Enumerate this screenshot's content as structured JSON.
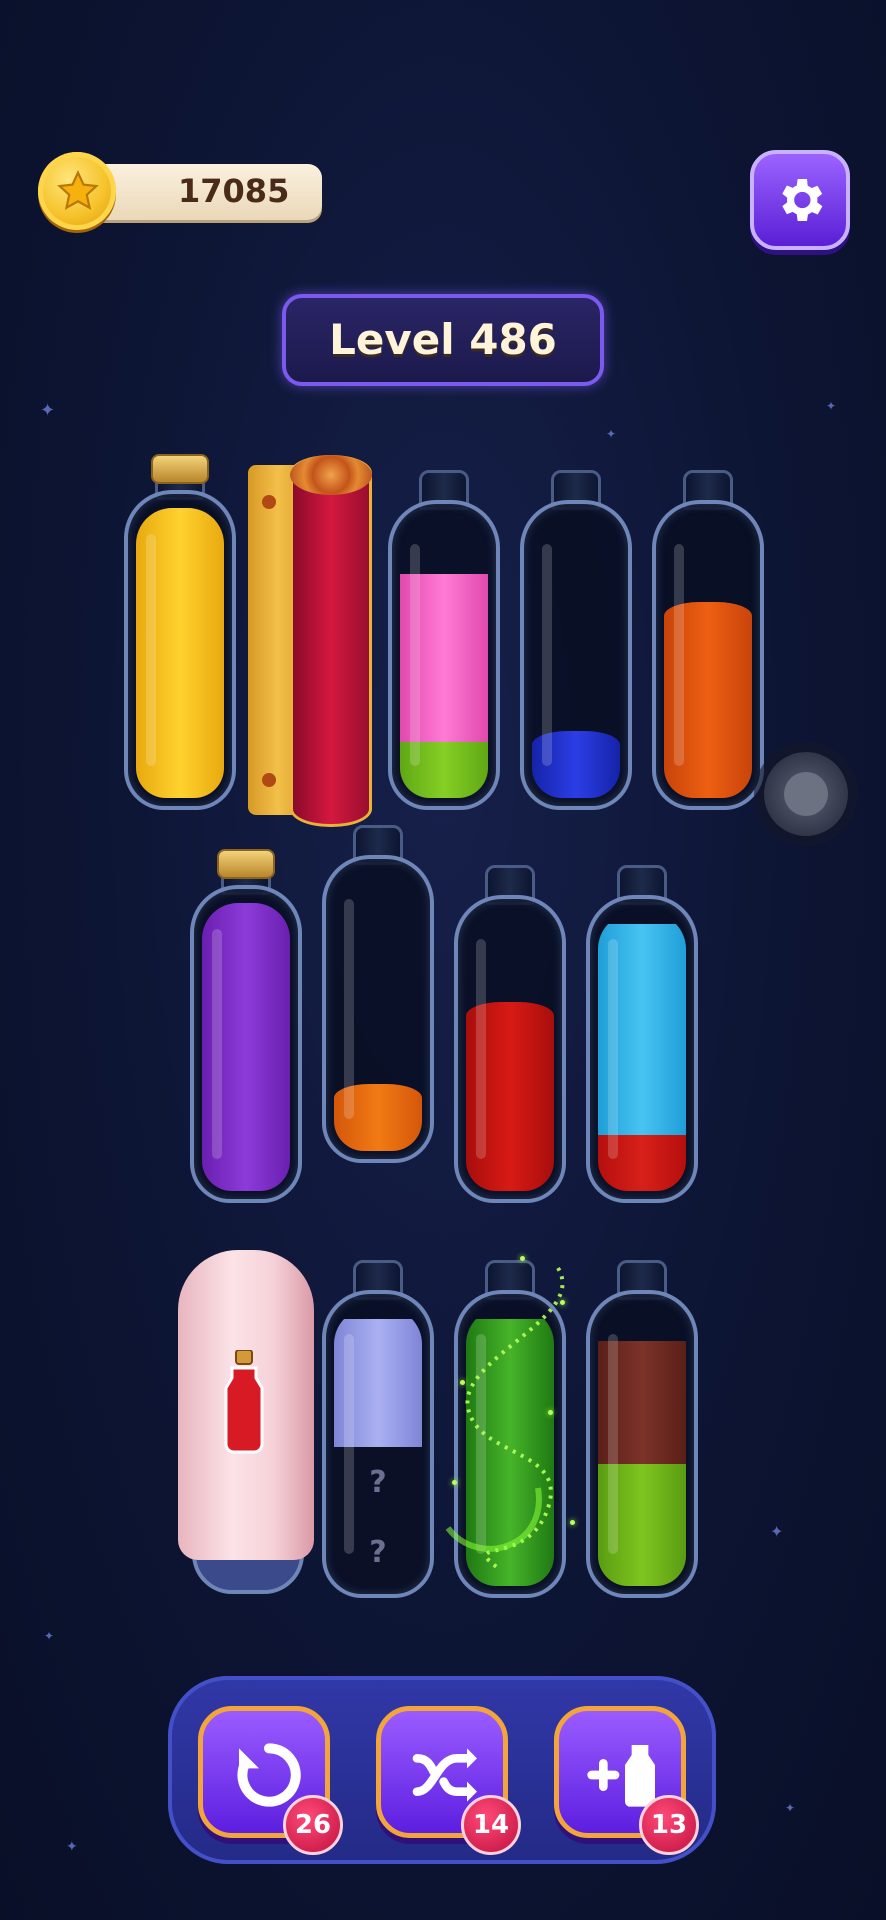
{
  "currency": {
    "coins": "17085",
    "icon": "star-coin-icon"
  },
  "header": {
    "level_title": "Level 486",
    "settings_icon": "gear-icon"
  },
  "bottles_row1": [
    {
      "type": "corked",
      "layers": [
        "#f6c21c"
      ]
    },
    {
      "type": "scroll"
    },
    {
      "type": "open",
      "layers": [
        "#7cc221",
        "#f25ac4"
      ],
      "fill": [
        0.2,
        0.58
      ]
    },
    {
      "type": "open",
      "layers": [
        "#1f2fd0"
      ],
      "fill": [
        0.24
      ]
    },
    {
      "type": "open",
      "layers": [
        "#e0550c"
      ],
      "fill": [
        0.7
      ]
    }
  ],
  "bottles_row2": [
    {
      "type": "corked",
      "layers": [
        "#7c2bc4"
      ]
    },
    {
      "type": "open",
      "layers": [
        "#e8650e"
      ],
      "fill": [
        0.27
      ]
    },
    {
      "type": "open",
      "layers": [
        "#c8140f"
      ],
      "fill": [
        0.67
      ]
    },
    {
      "type": "open",
      "layers": [
        "#c8140f",
        "#35b4ea"
      ],
      "fill": [
        0.2,
        0.67
      ]
    }
  ],
  "bottles_row3": [
    {
      "type": "cloth-covered",
      "hint_icon": "red-potion-icon"
    },
    {
      "type": "mystery",
      "layers": [
        "#9aa0e6"
      ],
      "unknown": [
        "?",
        "?"
      ]
    },
    {
      "type": "sparkling",
      "layers": [
        "#3aa51e"
      ]
    },
    {
      "type": "open",
      "layers": [
        "#6fb41a",
        "#6b2a22"
      ],
      "fill": [
        0.42,
        0.42
      ]
    }
  ],
  "toolbar": {
    "undo": {
      "icon": "undo-icon",
      "count": "26"
    },
    "shuffle": {
      "icon": "shuffle-icon",
      "count": "14"
    },
    "add_bottle": {
      "icon": "add-bottle-icon",
      "count": "13"
    }
  }
}
